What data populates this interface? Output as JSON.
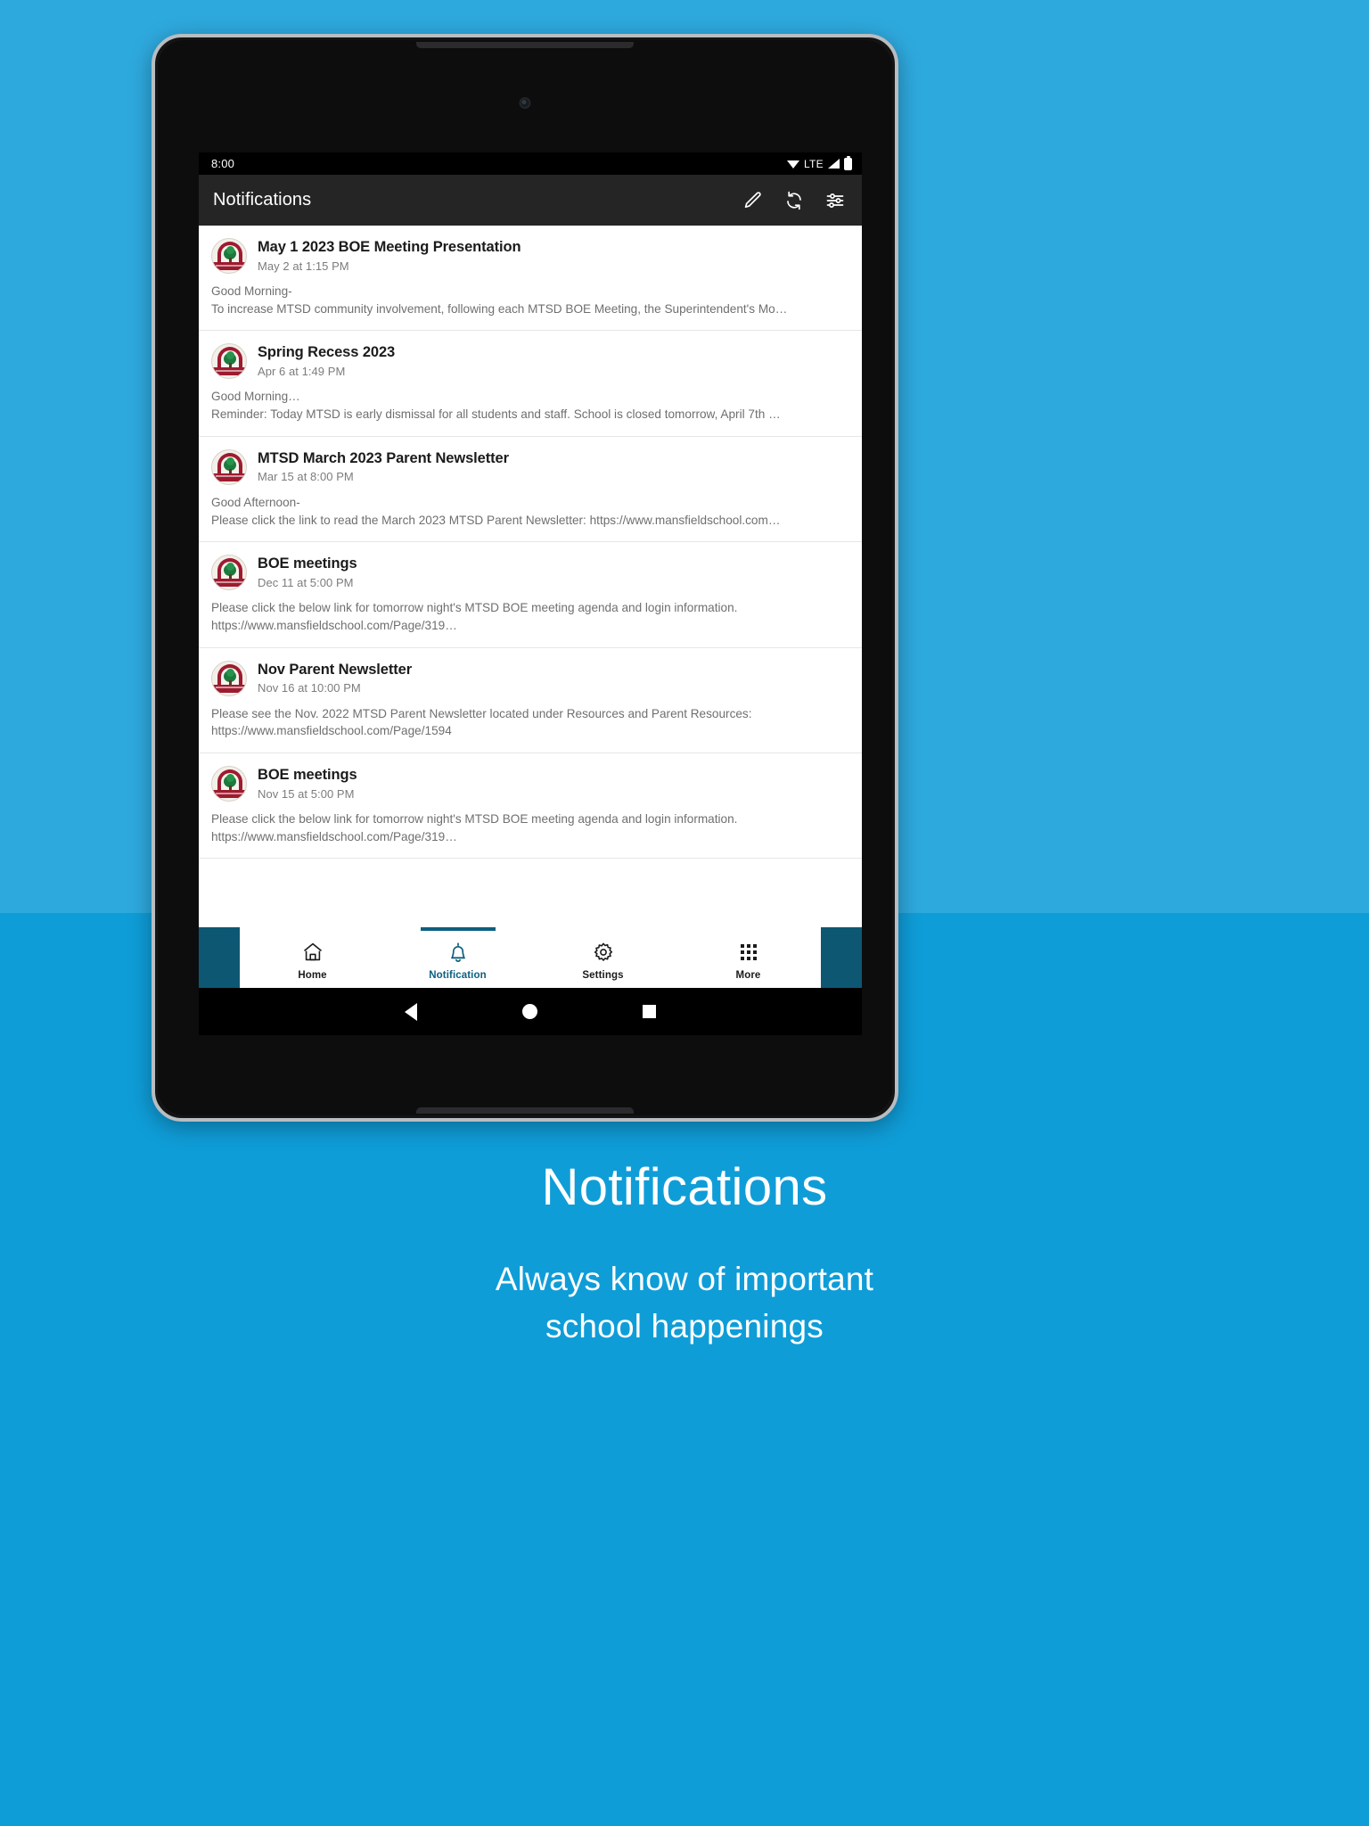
{
  "background": {
    "top_color": "#2ea9de",
    "bottom_color": "#0f9dd8"
  },
  "device": {
    "frame_color": "#b9bcc0",
    "body_color": "#0d0d0d"
  },
  "statusbar": {
    "clock": "8:00",
    "network_label": "LTE",
    "icons": [
      "wifi-icon",
      "signal-icon",
      "battery-icon"
    ]
  },
  "appbar": {
    "title": "Notifications",
    "background": "#252525",
    "actions": [
      {
        "name": "edit-icon",
        "label": "Edit"
      },
      {
        "name": "sync-icon",
        "label": "Refresh"
      },
      {
        "name": "filter-icon",
        "label": "Filter"
      }
    ]
  },
  "notifications": [
    {
      "title": "May 1 2023 BOE Meeting Presentation",
      "date": "May 2 at 1:15 PM",
      "body_line1": "Good Morning-",
      "body_line2": "To increase MTSD community involvement, following each MTSD BOE Meeting, the Superintendent's Mo…"
    },
    {
      "title": "Spring Recess 2023",
      "date": "Apr 6 at 1:49 PM",
      "body_line1": "Good Morning…",
      "body_line2": "Reminder: Today MTSD is early dismissal for all students and staff. School is closed tomorrow, April 7th …"
    },
    {
      "title": "MTSD March 2023 Parent Newsletter",
      "date": "Mar 15 at 8:00 PM",
      "body_line1": "Good Afternoon-",
      "body_line2": "Please click the link to read the March 2023 MTSD Parent Newsletter: https://www.mansfieldschool.com…"
    },
    {
      "title": "BOE meetings",
      "date": "Dec 11 at 5:00 PM",
      "body_line1": "Please click the below link for tomorrow night's MTSD BOE meeting agenda and login information.",
      "body_line2": "https://www.mansfieldschool.com/Page/319…"
    },
    {
      "title": "Nov Parent Newsletter",
      "date": "Nov 16 at 10:00 PM",
      "body_line1": "Please see the Nov. 2022 MTSD Parent Newsletter located under Resources and Parent Resources:",
      "body_line2": "https://www.mansfieldschool.com/Page/1594"
    },
    {
      "title": "BOE meetings",
      "date": "Nov 15 at 5:00 PM",
      "body_line1": "Please click the below link for tomorrow night's MTSD BOE meeting agenda and login information.",
      "body_line2": "https://www.mansfieldschool.com/Page/319…"
    }
  ],
  "tabbar": {
    "active_color": "#0d5f80",
    "inactive_color": "#1b1b1b",
    "side_block_color": "#0d5773",
    "tabs": [
      {
        "label": "Home",
        "icon": "home-icon",
        "active": false
      },
      {
        "label": "Notification",
        "icon": "bell-icon",
        "active": true
      },
      {
        "label": "Settings",
        "icon": "gear-icon",
        "active": false
      },
      {
        "label": "More",
        "icon": "grid-dots-icon",
        "active": false
      }
    ]
  },
  "navbar": {
    "buttons": [
      {
        "name": "back-icon"
      },
      {
        "name": "home-circle-icon"
      },
      {
        "name": "recents-square-icon"
      }
    ]
  },
  "caption": {
    "headline": "Notifications",
    "subline1": "Always know of important",
    "subline2": "school happenings"
  }
}
